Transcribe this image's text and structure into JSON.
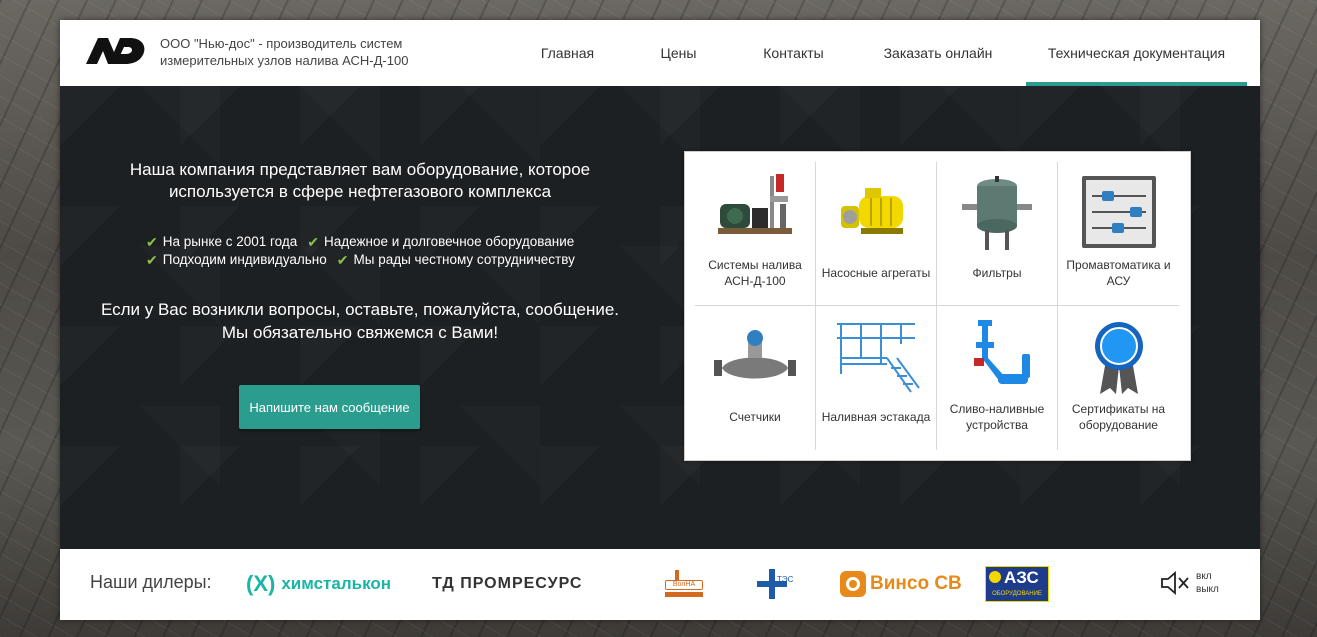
{
  "header": {
    "company": "ООО \"Нью-дос\" - производитель систем измерительных узлов налива АСН-Д-100",
    "nav": [
      {
        "label": "Главная",
        "active": false
      },
      {
        "label": "Цены",
        "active": false
      },
      {
        "label": "Контакты",
        "active": false
      },
      {
        "label": "Заказать онлайн",
        "active": false
      },
      {
        "label": "Техническая документация",
        "active": true
      }
    ]
  },
  "hero": {
    "intro": "Наша компания представляет вам оборудование, которое используется в сфере нефтегазового комплекса",
    "features": [
      "На рынке с 2001 года",
      "Надежное и долговечное оборудование",
      "Подходим индивидуально",
      "Мы рады честному сотрудничеству"
    ],
    "question": "Если у Вас возникли вопросы, оставьте, пожалуйста, сообщение. Мы обязательно свяжемся с Вами!",
    "cta_label": "Напишите нам сообщение"
  },
  "products": [
    {
      "label": "Системы налива АСН-Д-100",
      "icon": "filling-system-icon"
    },
    {
      "label": "Насосные агрегаты",
      "icon": "pump-icon"
    },
    {
      "label": "Фильтры",
      "icon": "filter-icon"
    },
    {
      "label": "Промавтоматика и АСУ",
      "icon": "automation-icon"
    },
    {
      "label": "Счетчики",
      "icon": "flow-meter-icon"
    },
    {
      "label": "Наливная эстакада",
      "icon": "loading-rack-icon"
    },
    {
      "label": "Сливо-наливные устройства",
      "icon": "loading-arm-icon"
    },
    {
      "label": "Сертификаты на оборудование",
      "icon": "certificate-icon"
    }
  ],
  "dealers": {
    "label": "Наши дилеры:",
    "items": [
      "химсталькон",
      "ТД ПРОМРЕСУРС",
      "ВолНА",
      "ТЭС",
      "Винсо СВ",
      "АЗС",
      "ОБОРУДОВАНИЕ"
    ]
  },
  "sound": {
    "on": "вкл",
    "off": "выкл"
  },
  "colors": {
    "accent": "#2a9d8f",
    "check": "#8bc34a",
    "dark": "#1d2022",
    "hims": "#1ab5a5",
    "vinso": "#e88a1a",
    "azs_blue": "#1d3c8c"
  }
}
